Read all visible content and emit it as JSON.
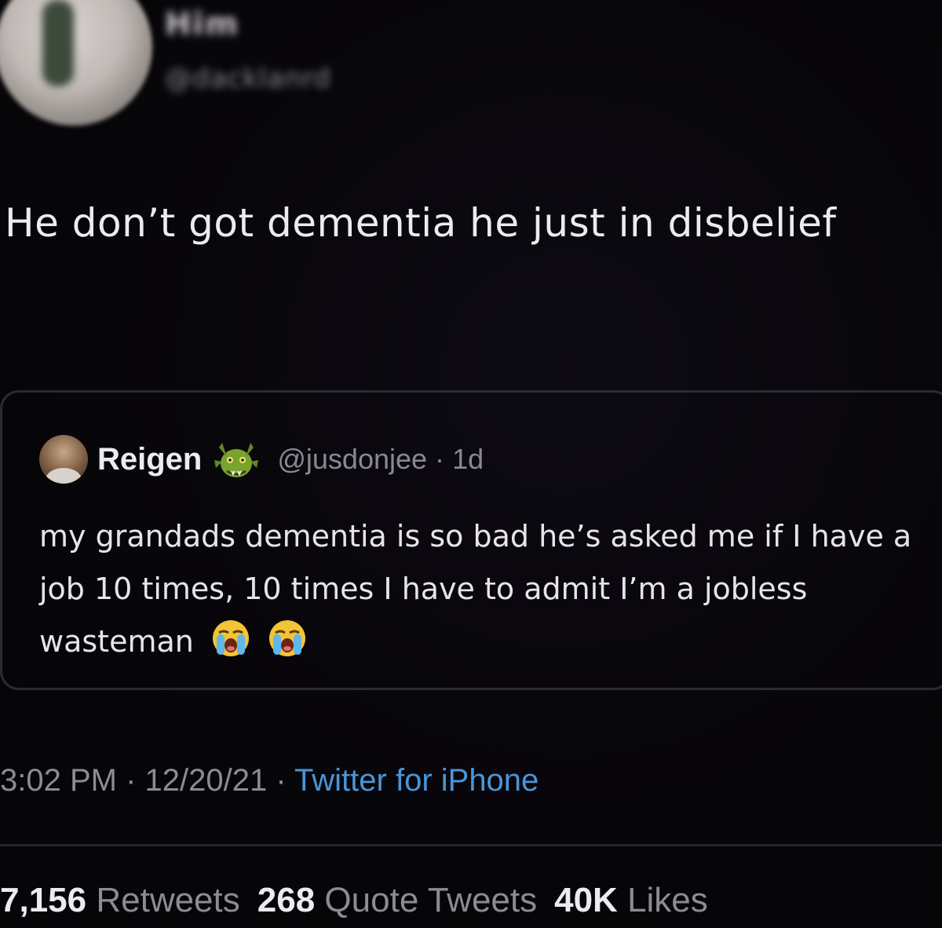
{
  "author": {
    "name": "Him",
    "handle": "@dacklanrd",
    "avatar_icon": "profile-photo-blurred"
  },
  "tweet": {
    "text": "He don’t got dementia he just in disbelief"
  },
  "quoted_tweet": {
    "name": "Reigen",
    "name_badge_icon": "green-dragon-emoji",
    "handle": "@jusdonjee",
    "separator": "·",
    "age": "1d",
    "text": "my grandads dementia is so bad he’s asked me if I have a job 10 times, 10 times I have to admit I’m a jobless wasteman",
    "trailing_emojis": [
      "loudly-crying-face-emoji",
      "loudly-crying-face-emoji"
    ]
  },
  "meta": {
    "time": "3:02 PM",
    "sep1": " · ",
    "date": "12/20/21",
    "sep2": " · ",
    "source": "Twitter for iPhone",
    "source_color": "#4a95d8"
  },
  "stats": {
    "retweets_count": "7,156",
    "retweets_label": "Retweets",
    "quotes_count": "268",
    "quotes_label": "Quote Tweets",
    "likes_count": "40K",
    "likes_label": "Likes"
  }
}
